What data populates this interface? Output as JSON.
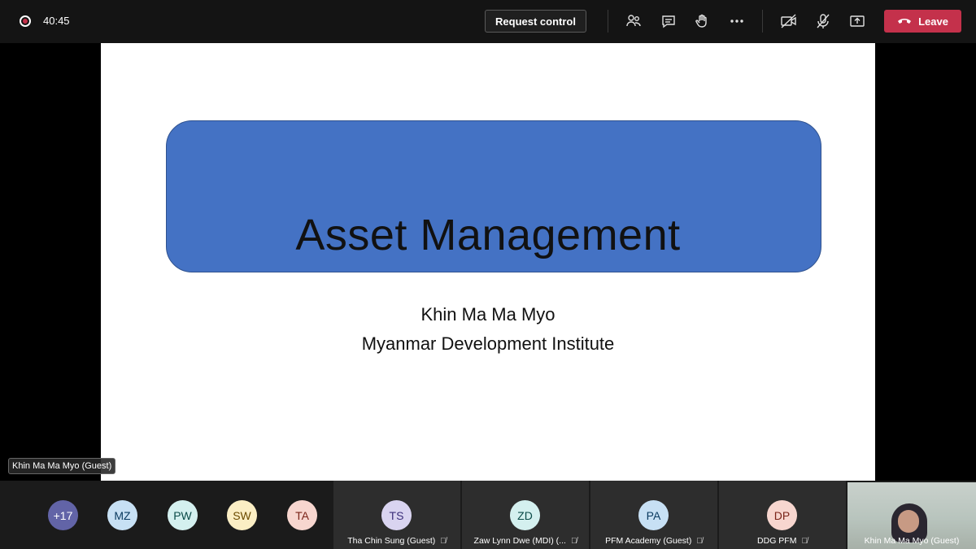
{
  "topbar": {
    "timer": "40:45",
    "request_control": "Request control",
    "leave": "Leave",
    "icons": [
      "people-icon",
      "chat-icon",
      "raise-hand-icon",
      "more-icon",
      "camera-off-icon",
      "mic-off-icon",
      "share-icon"
    ]
  },
  "slide": {
    "title": "Asset Management",
    "presenter": "Khin Ma Ma Myo",
    "organization": "Myanmar Development Institute"
  },
  "presenter_tag": "Khin Ma Ma Myo (Guest)",
  "strip": {
    "overflow": "+17",
    "avatars": [
      {
        "initials": "MZ",
        "bg": "#c7e0f4",
        "fg": "#0b3b60"
      },
      {
        "initials": "PW",
        "bg": "#d4f0ef",
        "fg": "#0b4b48"
      },
      {
        "initials": "SW",
        "bg": "#fbeec4",
        "fg": "#6b4a00"
      },
      {
        "initials": "TA",
        "bg": "#f7d6cf",
        "fg": "#7a2419"
      }
    ],
    "tiles": [
      {
        "initials": "TS",
        "name": "Tha Chin Sung (Guest)",
        "bg": "#d9d4f0",
        "fg": "#3b2e7a"
      },
      {
        "initials": "ZD",
        "name": "Zaw Lynn Dwe (MDI) (...",
        "bg": "#d4f0ef",
        "fg": "#0b4b48"
      },
      {
        "initials": "PA",
        "name": "PFM Academy (Guest)",
        "bg": "#c7e0f4",
        "fg": "#0b3b60"
      },
      {
        "initials": "DP",
        "name": "DDG PFM",
        "bg": "#f7d6cf",
        "fg": "#7a2419"
      }
    ],
    "self_name": "Khin Ma Ma Myo (Guest)"
  },
  "colors": {
    "accent_leave": "#c4314b",
    "slide_box": "#4472c4",
    "overflow_avatar": "#6264a7"
  }
}
